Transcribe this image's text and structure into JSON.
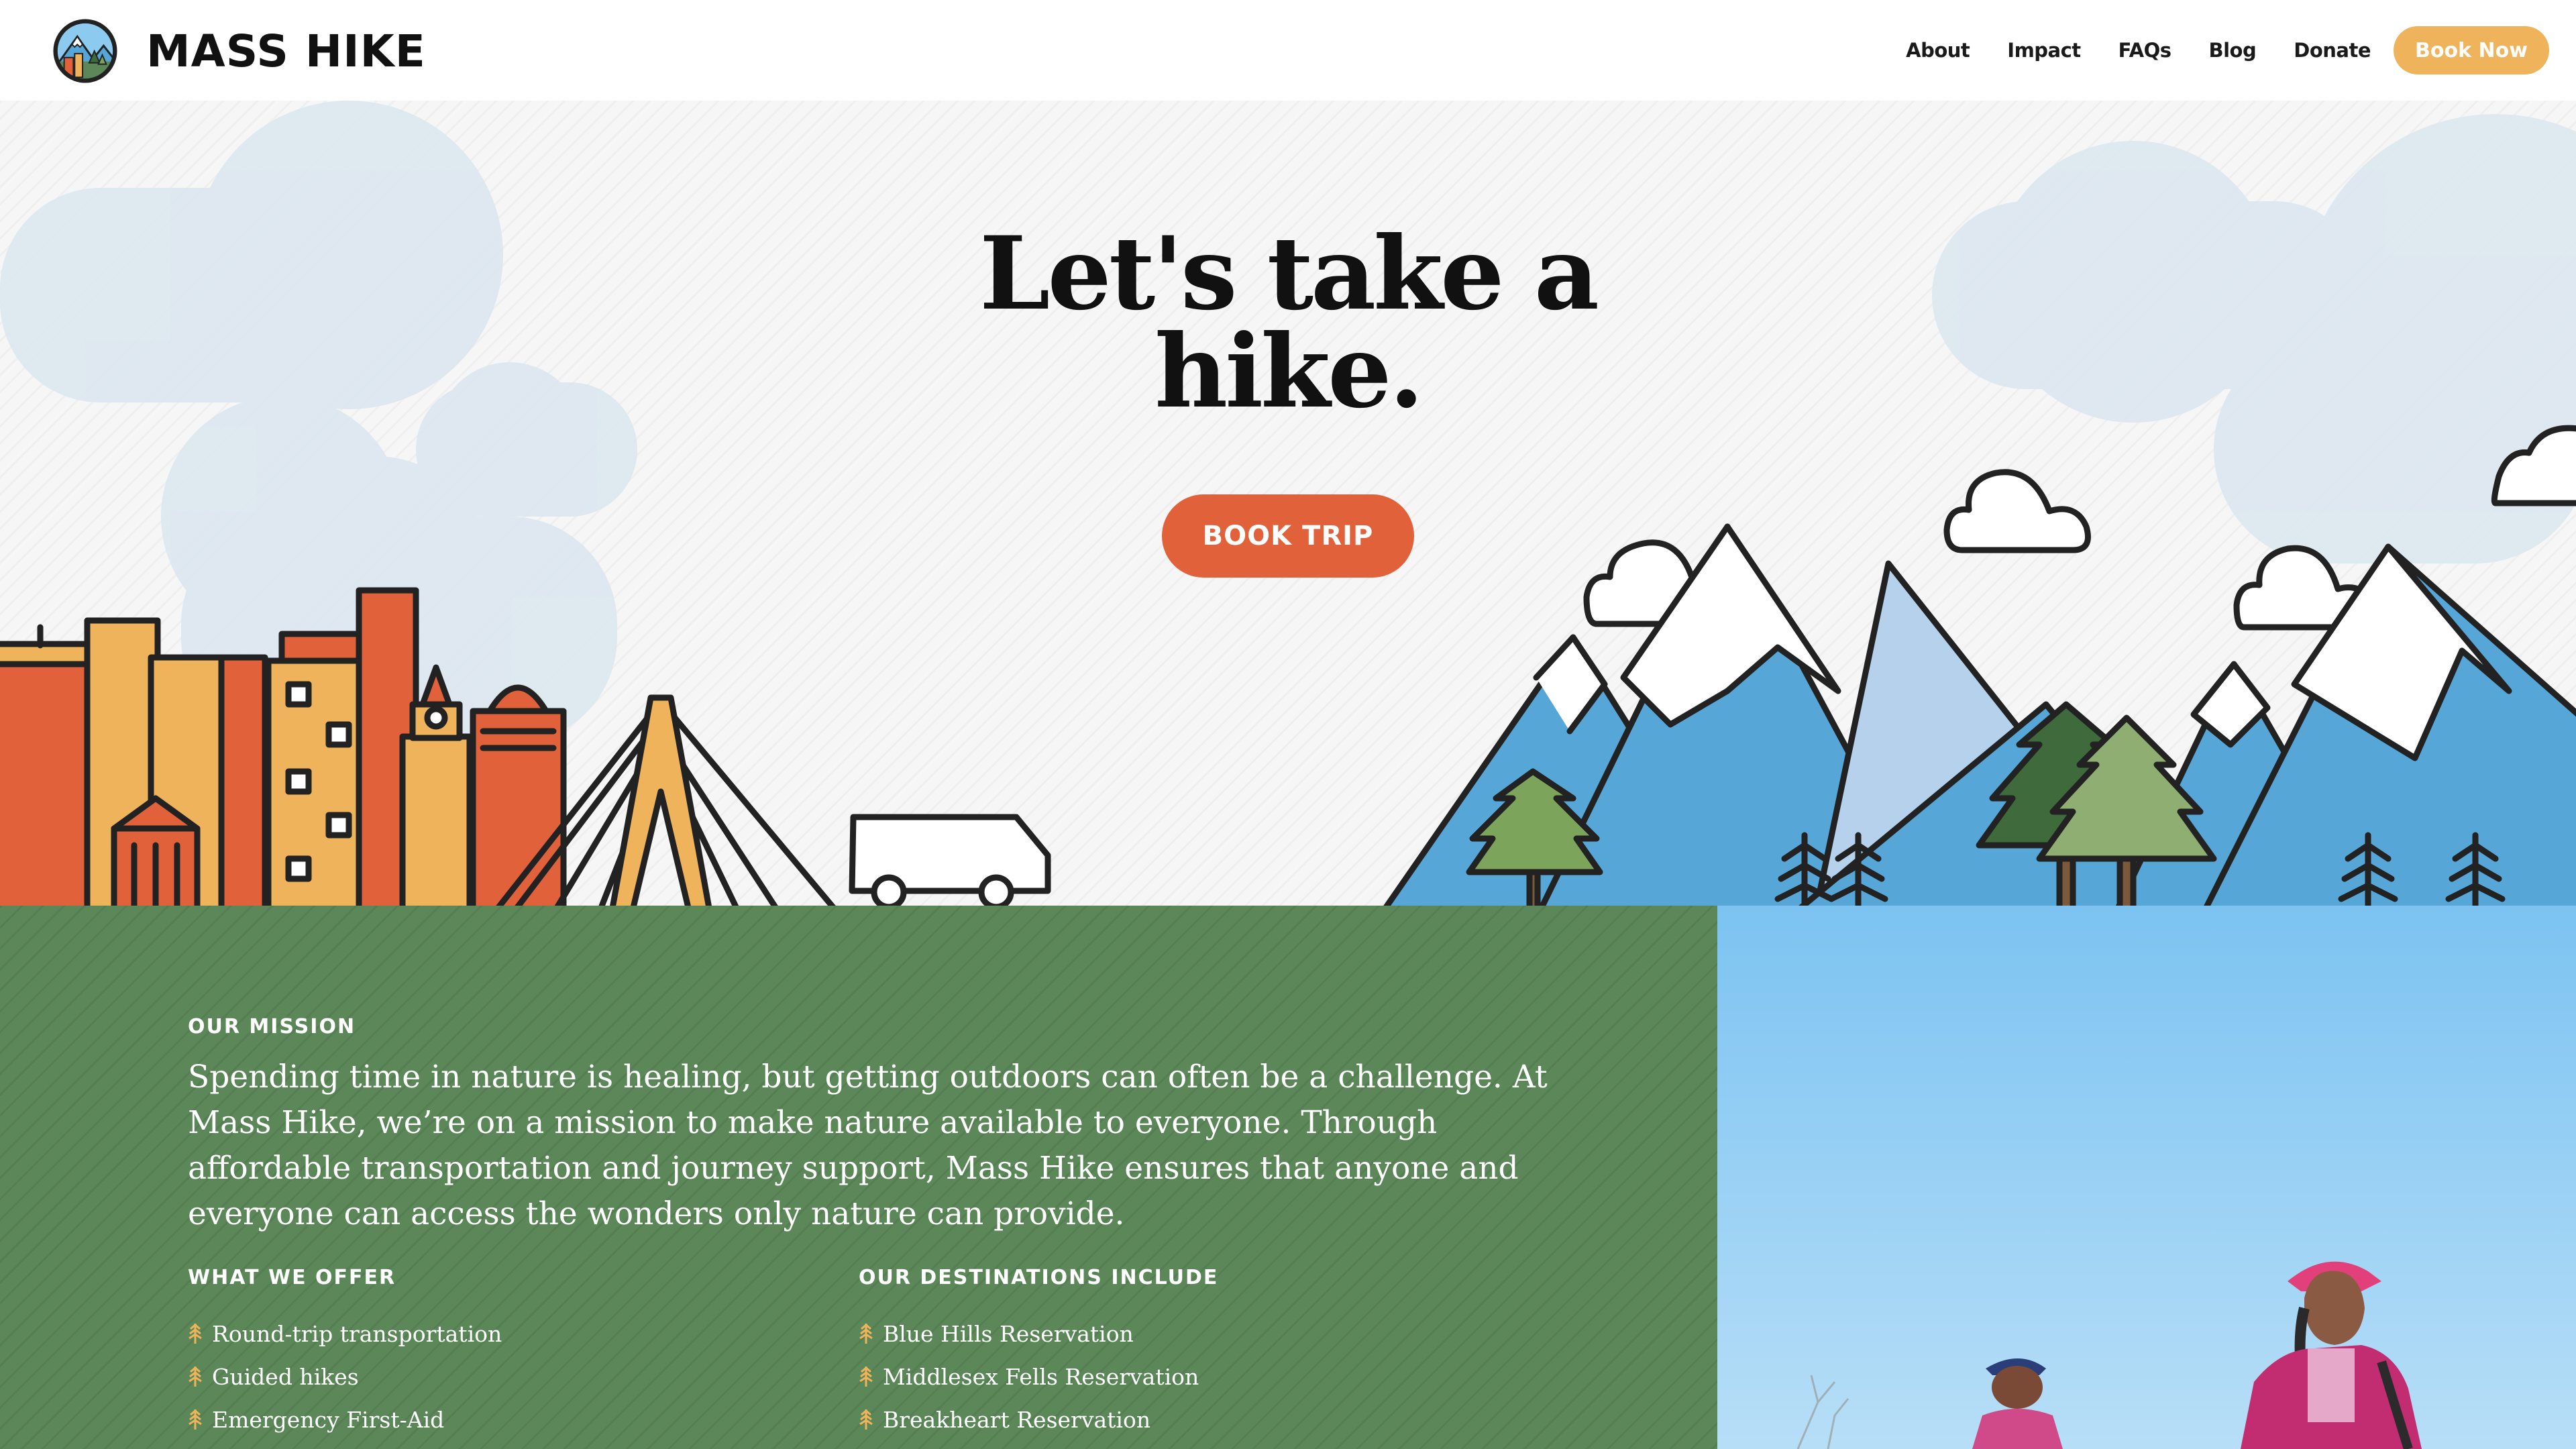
{
  "nav": {
    "logo_text": "MASS HIKE",
    "links": [
      "About",
      "Impact",
      "FAQs",
      "Blog",
      "Donate"
    ],
    "cta_label": "Book Now"
  },
  "hero": {
    "title": "Let's take a hike.",
    "cta_label": "BOOK TRIP"
  },
  "mission": {
    "label": "OUR MISSION",
    "text": "Spending time in nature is healing, but getting outdoors can often be a challenge. At Mass Hike, we’re on a mission to make nature available to everyone. Through affordable transportation and journey support, Mass Hike ensures that anyone and everyone can access the wonders only nature can provide.",
    "offer_label": "WHAT WE OFFER",
    "offer_items": [
      "Round-trip transportation",
      "Guided hikes",
      "Emergency First-Aid"
    ],
    "destinations_label": "OUR DESTINATIONS INCLUDE",
    "destination_items": [
      "Blue Hills Reservation",
      "Middlesex Fells Reservation",
      "Breakheart Reservation"
    ]
  },
  "colors": {
    "accent_orange": "#e1623a",
    "accent_gold": "#efb45b",
    "mission_green": "#5b8759",
    "mountain_blue": "#56a6d8",
    "sky_blue": "#8ccaf0"
  },
  "icons": [
    "mountain-badge-logo",
    "tree-icon",
    "cloud-icon",
    "van-icon"
  ]
}
